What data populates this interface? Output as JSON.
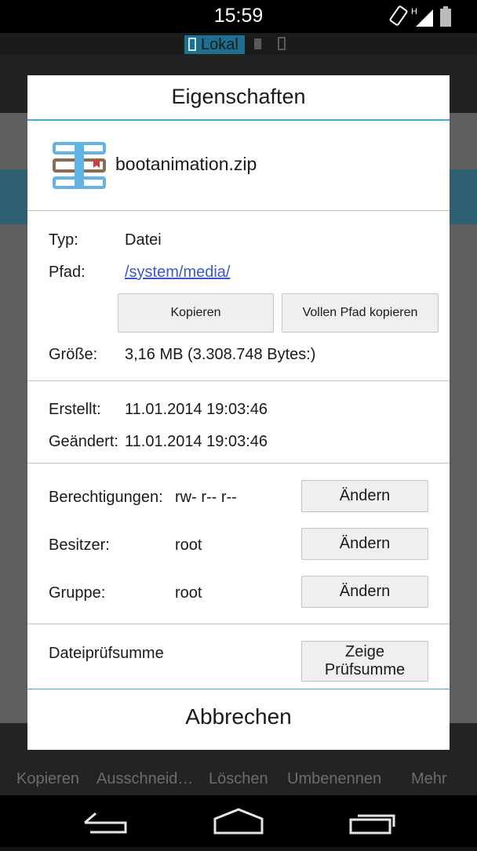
{
  "status_bar": {
    "time": "15:59",
    "network": "H"
  },
  "app": {
    "location_tab": "Lokal",
    "bottom_bar": [
      "Kopieren",
      "Ausschneid…",
      "Löschen",
      "Umbenennen",
      "Mehr"
    ]
  },
  "dialog": {
    "title": "Eigenschaften",
    "file_name": "bootanimation.zip",
    "type_label": "Typ:",
    "type_value": "Datei",
    "path_label": "Pfad:",
    "path_value": "/system/media/",
    "copy_button": "Kopieren",
    "copy_full_path_button": "Vollen Pfad kopieren",
    "size_label": "Größe:",
    "size_value": "3,16 MB (3.308.748 Bytes:)",
    "created_label": "Erstellt:",
    "created_value": "11.01.2014 19:03:46",
    "modified_label": "Geändert:",
    "modified_value": "11.01.2014 19:03:46",
    "permissions_label": "Berechtigungen:",
    "permissions_value": "rw- r-- r--",
    "owner_label": "Besitzer:",
    "owner_value": "root",
    "group_label": "Gruppe:",
    "group_value": "root",
    "change_button": "Ändern",
    "checksum_label": "Dateiprüfsumme",
    "show_checksum_button": "Zeige Prüfsumme",
    "cancel_button": "Abbrechen"
  },
  "colors": {
    "accent": "#46a8d8",
    "link": "#3b56d4",
    "tab_highlight": "#1d6f8e"
  }
}
